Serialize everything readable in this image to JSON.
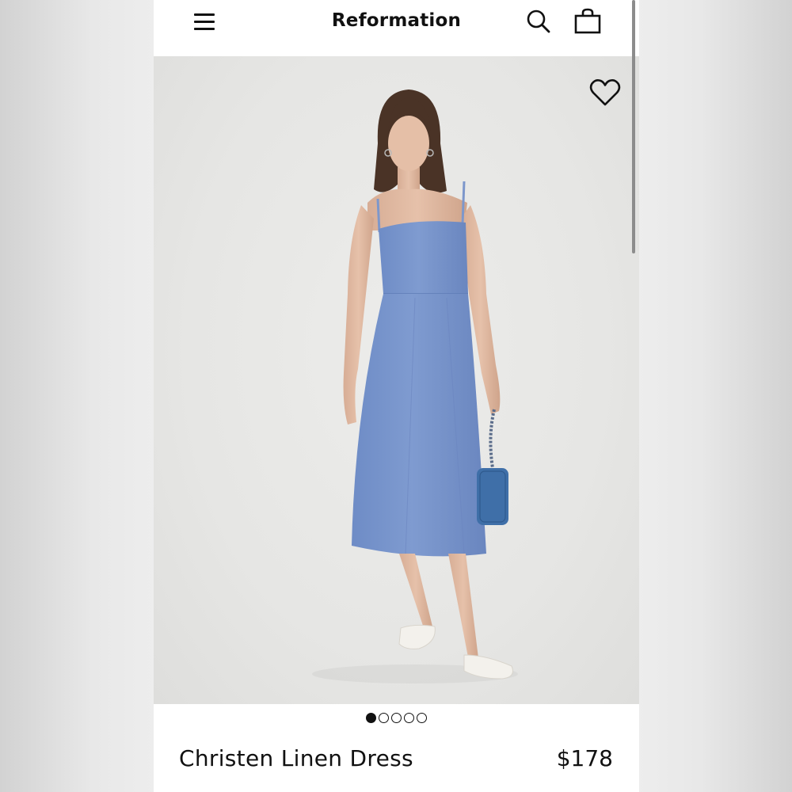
{
  "header": {
    "brand": "Reformation",
    "menu_icon": "hamburger-menu-icon",
    "search_icon": "search-icon",
    "bag_icon": "shopping-bag-icon"
  },
  "product": {
    "name": "Christen Linen Dress",
    "price": "$178",
    "favorite_icon": "heart-outline-icon",
    "image_description_hidden": ""
  },
  "carousel": {
    "total_images": 5,
    "active_index": 0
  },
  "colors": {
    "background": "#ffffff",
    "photo_backdrop": "#e6e6e4",
    "dress": "#7b97cc",
    "text": "#111111"
  }
}
